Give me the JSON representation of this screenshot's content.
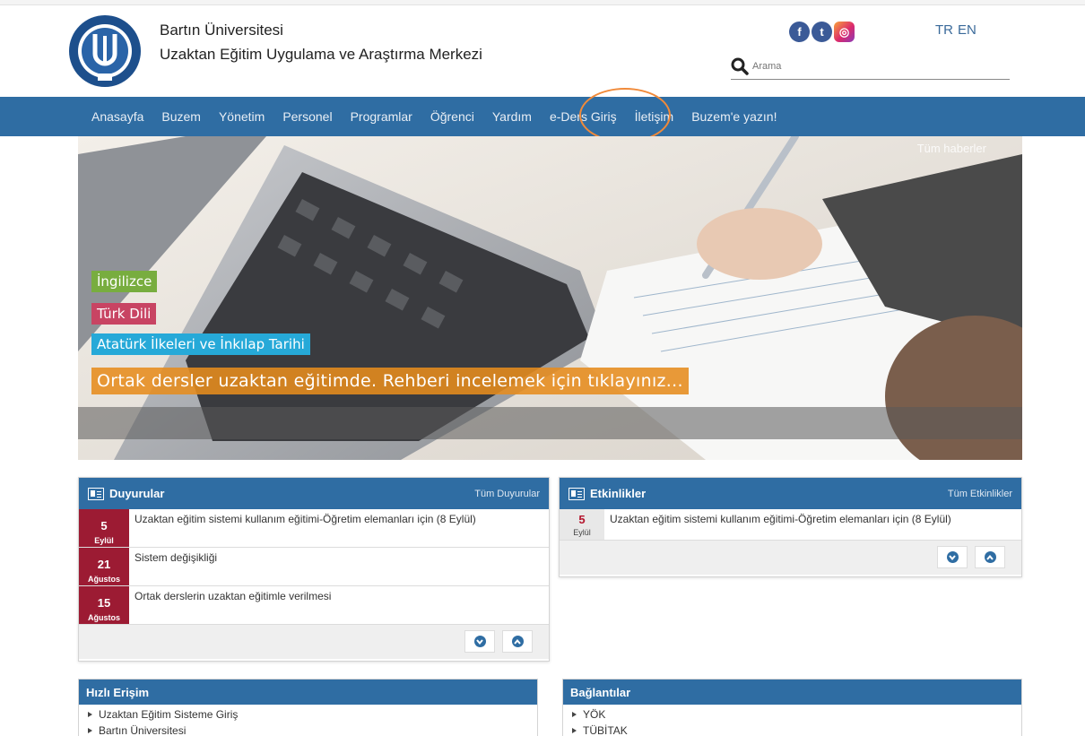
{
  "header": {
    "university": "Bartın Üniversitesi",
    "center": "Uzaktan Eğitim Uygulama ve Araştırma Merkezi",
    "logo_text": "BARTIN ÜNİVERSİTESİ 2008",
    "languages": [
      "TR",
      "EN"
    ],
    "search_placeholder": "Arama",
    "social": [
      "facebook-icon",
      "twitter-icon",
      "instagram-icon"
    ]
  },
  "nav": {
    "items": [
      "Anasayfa",
      "Buzem",
      "Yönetim",
      "Personel",
      "Programlar",
      "Öğrenci",
      "Yardım",
      "e-Ders Giriş",
      "İletişim",
      "Buzem'e yazın!"
    ],
    "highlighted_index": 7,
    "highlight_color": "#f08a3a"
  },
  "hero": {
    "all_news": "Tüm haberler",
    "tags": [
      "İngilizce",
      "Türk Dili",
      "Atatürk İlkeleri ve İnkılap Tarihi"
    ],
    "cta": "Ortak dersler uzaktan eğitimde. Rehberi incelemek için tıklayınız..."
  },
  "announcements": {
    "title": "Duyurular",
    "all_link": "Tüm Duyurular",
    "items": [
      {
        "day": "5",
        "month": "Eylül",
        "text": "Uzaktan eğitim sistemi kullanım eğitimi-Öğretim elemanları için (8 Eylül)"
      },
      {
        "day": "21",
        "month": "Ağustos",
        "text": "Sistem değişikliği"
      },
      {
        "day": "15",
        "month": "Ağustos",
        "text": "Ortak derslerin uzaktan eğitimle verilmesi"
      }
    ]
  },
  "events": {
    "title": "Etkinlikler",
    "all_link": "Tüm Etkinlikler",
    "items": [
      {
        "day": "5",
        "month": "Eylül",
        "text": "Uzaktan eğitim sistemi kullanım eğitimi-Öğretim elemanları için (8 Eylül)"
      }
    ]
  },
  "quick_access": {
    "title": "Hızlı Erişim",
    "items": [
      "Uzaktan Eğitim Sisteme Giriş",
      "Bartın Üniversitesi"
    ]
  },
  "links": {
    "title": "Bağlantılar",
    "items": [
      "YÖK",
      "TÜBİTAK"
    ]
  },
  "colors": {
    "brand_blue": "#2f6da3",
    "date_red": "#9c1b33",
    "tag_green": "#78ad3f",
    "tag_pink": "#c84463",
    "tag_cyan": "#26a9d8",
    "tag_orange": "#e68c1e"
  }
}
